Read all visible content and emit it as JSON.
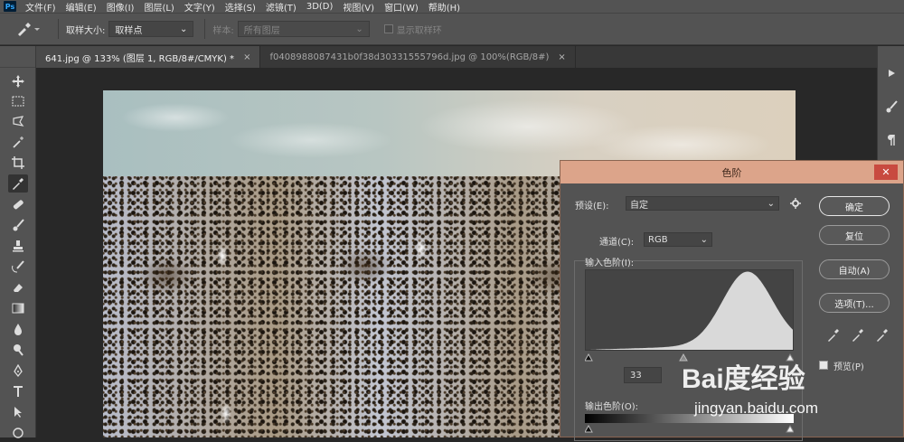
{
  "menubar": {
    "logo": "Ps",
    "items": [
      "文件(F)",
      "编辑(E)",
      "图像(I)",
      "图层(L)",
      "文字(Y)",
      "选择(S)",
      "滤镜(T)",
      "3D(D)",
      "视图(V)",
      "窗口(W)",
      "帮助(H)"
    ]
  },
  "options": {
    "sample_size_label": "取样大小:",
    "sample_size_value": "取样点",
    "sample_label": "样本:",
    "sample_value": "所有图层",
    "show_ring_label": "显示取样环"
  },
  "tabs": [
    {
      "label": "641.jpg @ 133% (图层 1, RGB/8#/CMYK) *",
      "close": "×"
    },
    {
      "label": "f0408988087431b0f38d30331555796d.jpg @ 100%(RGB/8#)",
      "close": "×"
    }
  ],
  "levels": {
    "title": "色阶",
    "close": "✕",
    "preset_label": "预设(E):",
    "preset_value": "自定",
    "channel_label": "通道(C):",
    "channel_value": "RGB",
    "input_label": "输入色阶(I):",
    "input_black": "33",
    "output_label": "输出色阶(O):",
    "buttons": {
      "ok": "确定",
      "reset": "复位",
      "auto": "自动(A)",
      "options": "选项(T)..."
    },
    "preview_label": "预览(P)",
    "histogram_peak_fraction": 0.78
  },
  "watermark": {
    "brand": "Bai度经验",
    "url": "jingyan.baidu.com"
  }
}
